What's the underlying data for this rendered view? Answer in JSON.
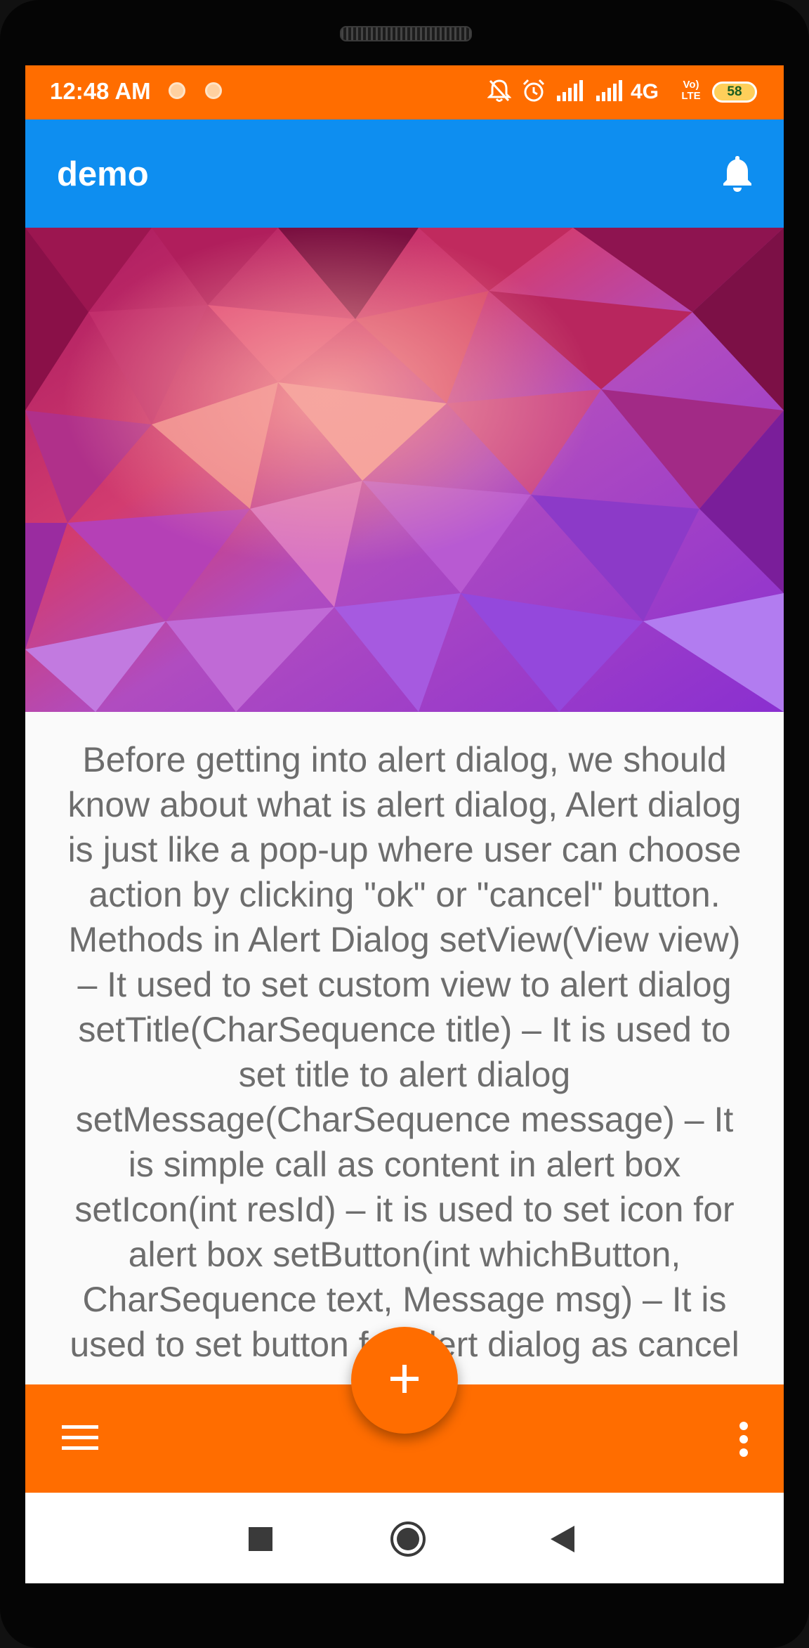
{
  "status_bar": {
    "time": "12:48 AM",
    "network": "4G",
    "volte": "Vo) LTE",
    "battery": "58",
    "background": "#ff6d00",
    "icons": [
      "notification-dot-icon",
      "notification-dot-icon",
      "mute-bell-icon",
      "alarm-icon",
      "signal-icon",
      "signal-icon",
      "volte-icon",
      "battery-icon"
    ]
  },
  "app_bar": {
    "title": "demo",
    "background": "#0e8ef0",
    "action_icon": "bell-icon"
  },
  "hero": {
    "description_icon": "polygon-background-image"
  },
  "content": {
    "text": "Before getting into alert dialog, we should know about what is alert dialog, Alert dialog is just like a pop-up where user can choose action by clicking \"ok\" or \"cancel\" button.  Methods in Alert Dialog setView(View view) – It used to set custom view to alert dialog  setTitle(CharSequence title) – It is used to set title to alert dialog setMessage(CharSequence message) – It is simple call as content in alert box setIcon(int resId) – it is used to set icon for alert box  setButton(int whichButton, CharSequence text, Message msg) – It is used to set button for alert dialog as cancel"
  },
  "bottom_bar": {
    "background": "#ff6d00",
    "left_icon": "menu-icon",
    "right_icon": "more-vert-icon",
    "fab_icon": "plus-icon"
  },
  "nav_bar": {
    "icons": [
      "recents-square-icon",
      "home-circle-icon",
      "back-triangle-icon"
    ]
  }
}
